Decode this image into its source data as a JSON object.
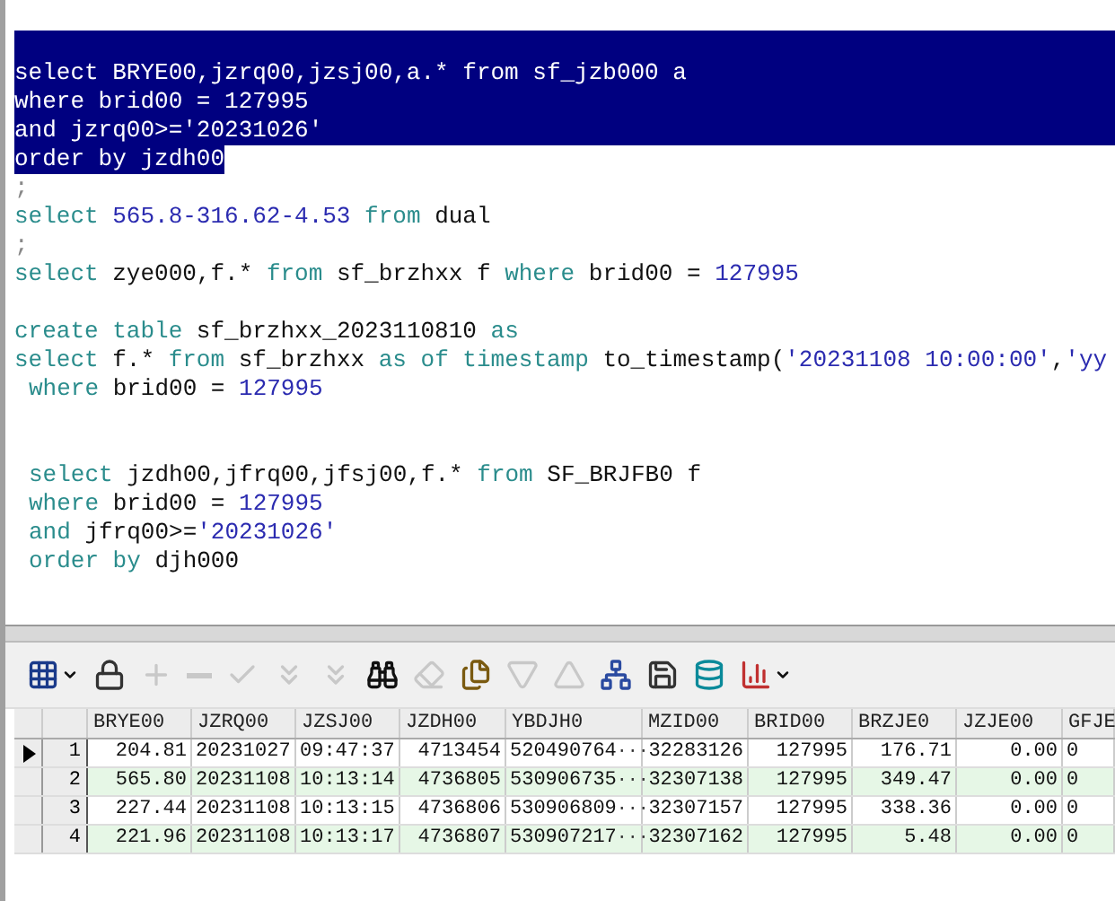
{
  "editor": {
    "lines": [
      {
        "selected": true,
        "partial": false
      },
      {
        "selected": true,
        "partial": false,
        "tokens": [
          {
            "t": "select BRYE00,jzrq00,jzsj00,a.* from sf_jzb000 a",
            "kind": "id"
          }
        ]
      },
      {
        "selected": true,
        "partial": false,
        "tokens": [
          {
            "t": "where brid00 = 127995",
            "kind": "id"
          }
        ]
      },
      {
        "selected": true,
        "partial": false,
        "tokens": [
          {
            "t": "and jzrq00>='20231026'",
            "kind": "id"
          }
        ]
      },
      {
        "selected": true,
        "partial": true,
        "tokens": [
          {
            "t": "order by jzdh00",
            "kind": "id"
          }
        ]
      },
      {
        "selected": false,
        "tokens": [
          {
            "t": ";",
            "kind": "punct"
          }
        ]
      },
      {
        "selected": false,
        "tokens": [
          {
            "t": "select ",
            "kind": "kw"
          },
          {
            "t": "565.8-316.62-4.53 ",
            "kind": "num"
          },
          {
            "t": "from",
            "kind": "kw"
          },
          {
            "t": " dual",
            "kind": "id"
          }
        ]
      },
      {
        "selected": false,
        "tokens": [
          {
            "t": ";",
            "kind": "punct"
          }
        ]
      },
      {
        "selected": false,
        "tokens": [
          {
            "t": "select",
            "kind": "kw"
          },
          {
            "t": " zye000,f.* ",
            "kind": "id"
          },
          {
            "t": "from",
            "kind": "kw"
          },
          {
            "t": " sf_brzhxx f ",
            "kind": "id"
          },
          {
            "t": "where",
            "kind": "kw"
          },
          {
            "t": " brid00 = ",
            "kind": "id"
          },
          {
            "t": "127995",
            "kind": "num"
          }
        ]
      },
      {
        "selected": false
      },
      {
        "selected": false,
        "tokens": [
          {
            "t": "create table",
            "kind": "kw"
          },
          {
            "t": " sf_brzhxx_2023110810 ",
            "kind": "id"
          },
          {
            "t": "as",
            "kind": "kw"
          }
        ]
      },
      {
        "selected": false,
        "tokens": [
          {
            "t": "select",
            "kind": "kw"
          },
          {
            "t": " f.* ",
            "kind": "id"
          },
          {
            "t": "from",
            "kind": "kw"
          },
          {
            "t": " sf_brzhxx ",
            "kind": "id"
          },
          {
            "t": "as of timestamp",
            "kind": "kw"
          },
          {
            "t": " to_timestamp(",
            "kind": "id"
          },
          {
            "t": "'20231108 10:00:00'",
            "kind": "str"
          },
          {
            "t": ",",
            "kind": "id"
          },
          {
            "t": "'yy",
            "kind": "str"
          }
        ]
      },
      {
        "selected": false,
        "indented": true,
        "tokens": [
          {
            "t": "where",
            "kind": "kw"
          },
          {
            "t": " brid00 = ",
            "kind": "id"
          },
          {
            "t": "127995",
            "kind": "num"
          }
        ]
      },
      {
        "selected": false
      },
      {
        "selected": false
      },
      {
        "selected": false,
        "indented": true,
        "tokens": [
          {
            "t": "select",
            "kind": "kw"
          },
          {
            "t": " jzdh00,jfrq00,jfsj00,f.* ",
            "kind": "id"
          },
          {
            "t": "from",
            "kind": "kw"
          },
          {
            "t": " SF_BRJFB0 f",
            "kind": "id"
          }
        ]
      },
      {
        "selected": false,
        "indented": true,
        "tokens": [
          {
            "t": "where",
            "kind": "kw"
          },
          {
            "t": " brid00 = ",
            "kind": "id"
          },
          {
            "t": "127995",
            "kind": "num"
          }
        ]
      },
      {
        "selected": false,
        "indented": true,
        "tokens": [
          {
            "t": "and",
            "kind": "kw"
          },
          {
            "t": " jfrq00>=",
            "kind": "id"
          },
          {
            "t": "'20231026'",
            "kind": "str"
          }
        ]
      },
      {
        "selected": false,
        "indented": true,
        "tokens": [
          {
            "t": "order by",
            "kind": "kw"
          },
          {
            "t": " djh000",
            "kind": "id"
          }
        ]
      }
    ]
  },
  "toolbar": [
    {
      "kind": "grid",
      "disabled": false,
      "menu": true
    },
    {
      "kind": "lock",
      "disabled": false,
      "menu": false
    },
    {
      "kind": "add",
      "disabled": true,
      "menu": false
    },
    {
      "kind": "remove",
      "disabled": true,
      "menu": false
    },
    {
      "kind": "post",
      "disabled": true,
      "menu": false
    },
    {
      "kind": "fetch",
      "disabled": true,
      "menu": false
    },
    {
      "kind": "fetch",
      "disabled": true,
      "menu": false
    },
    {
      "kind": "find",
      "disabled": false,
      "menu": false
    },
    {
      "kind": "clear",
      "disabled": true,
      "menu": false
    },
    {
      "kind": "export",
      "disabled": false,
      "menu": false
    },
    {
      "kind": "next",
      "disabled": true,
      "menu": false
    },
    {
      "kind": "previous",
      "disabled": true,
      "menu": false
    },
    {
      "kind": "explain",
      "disabled": false,
      "menu": false
    },
    {
      "kind": "save",
      "disabled": false,
      "menu": false
    },
    {
      "kind": "query",
      "disabled": false,
      "menu": false
    },
    {
      "kind": "chart",
      "disabled": false,
      "menu": true
    }
  ],
  "grid": {
    "columns": [
      "BRYE00",
      "JZRQ00",
      "JZSJ00",
      "JZDH00",
      "YBDJH0",
      "MZID00",
      "BRID00",
      "BRZJE0",
      "JZJE00",
      "GFJE"
    ],
    "rows": [
      {
        "number": "1",
        "current": true,
        "cells": [
          "204.81",
          "20231027",
          "09:47:37",
          "4713454",
          "520490764",
          "32283126",
          "127995",
          "176.71",
          "0.00",
          "0"
        ],
        "lookup": "···"
      },
      {
        "number": "2",
        "current": false,
        "cells": [
          "565.80",
          "20231108",
          "10:13:14",
          "4736805",
          "530906735",
          "32307138",
          "127995",
          "349.47",
          "0.00",
          "0"
        ],
        "lookup": "···"
      },
      {
        "number": "3",
        "current": false,
        "cells": [
          "227.44",
          "20231108",
          "10:13:15",
          "4736806",
          "530906809",
          "32307157",
          "127995",
          "338.36",
          "0.00",
          "0"
        ],
        "lookup": "···"
      },
      {
        "number": "4",
        "current": false,
        "cells": [
          "221.96",
          "20231108",
          "10:13:17",
          "4736807",
          "530907217",
          "32307162",
          "127995",
          "5.48",
          "0.00",
          "0"
        ],
        "lookup": "···"
      }
    ]
  }
}
